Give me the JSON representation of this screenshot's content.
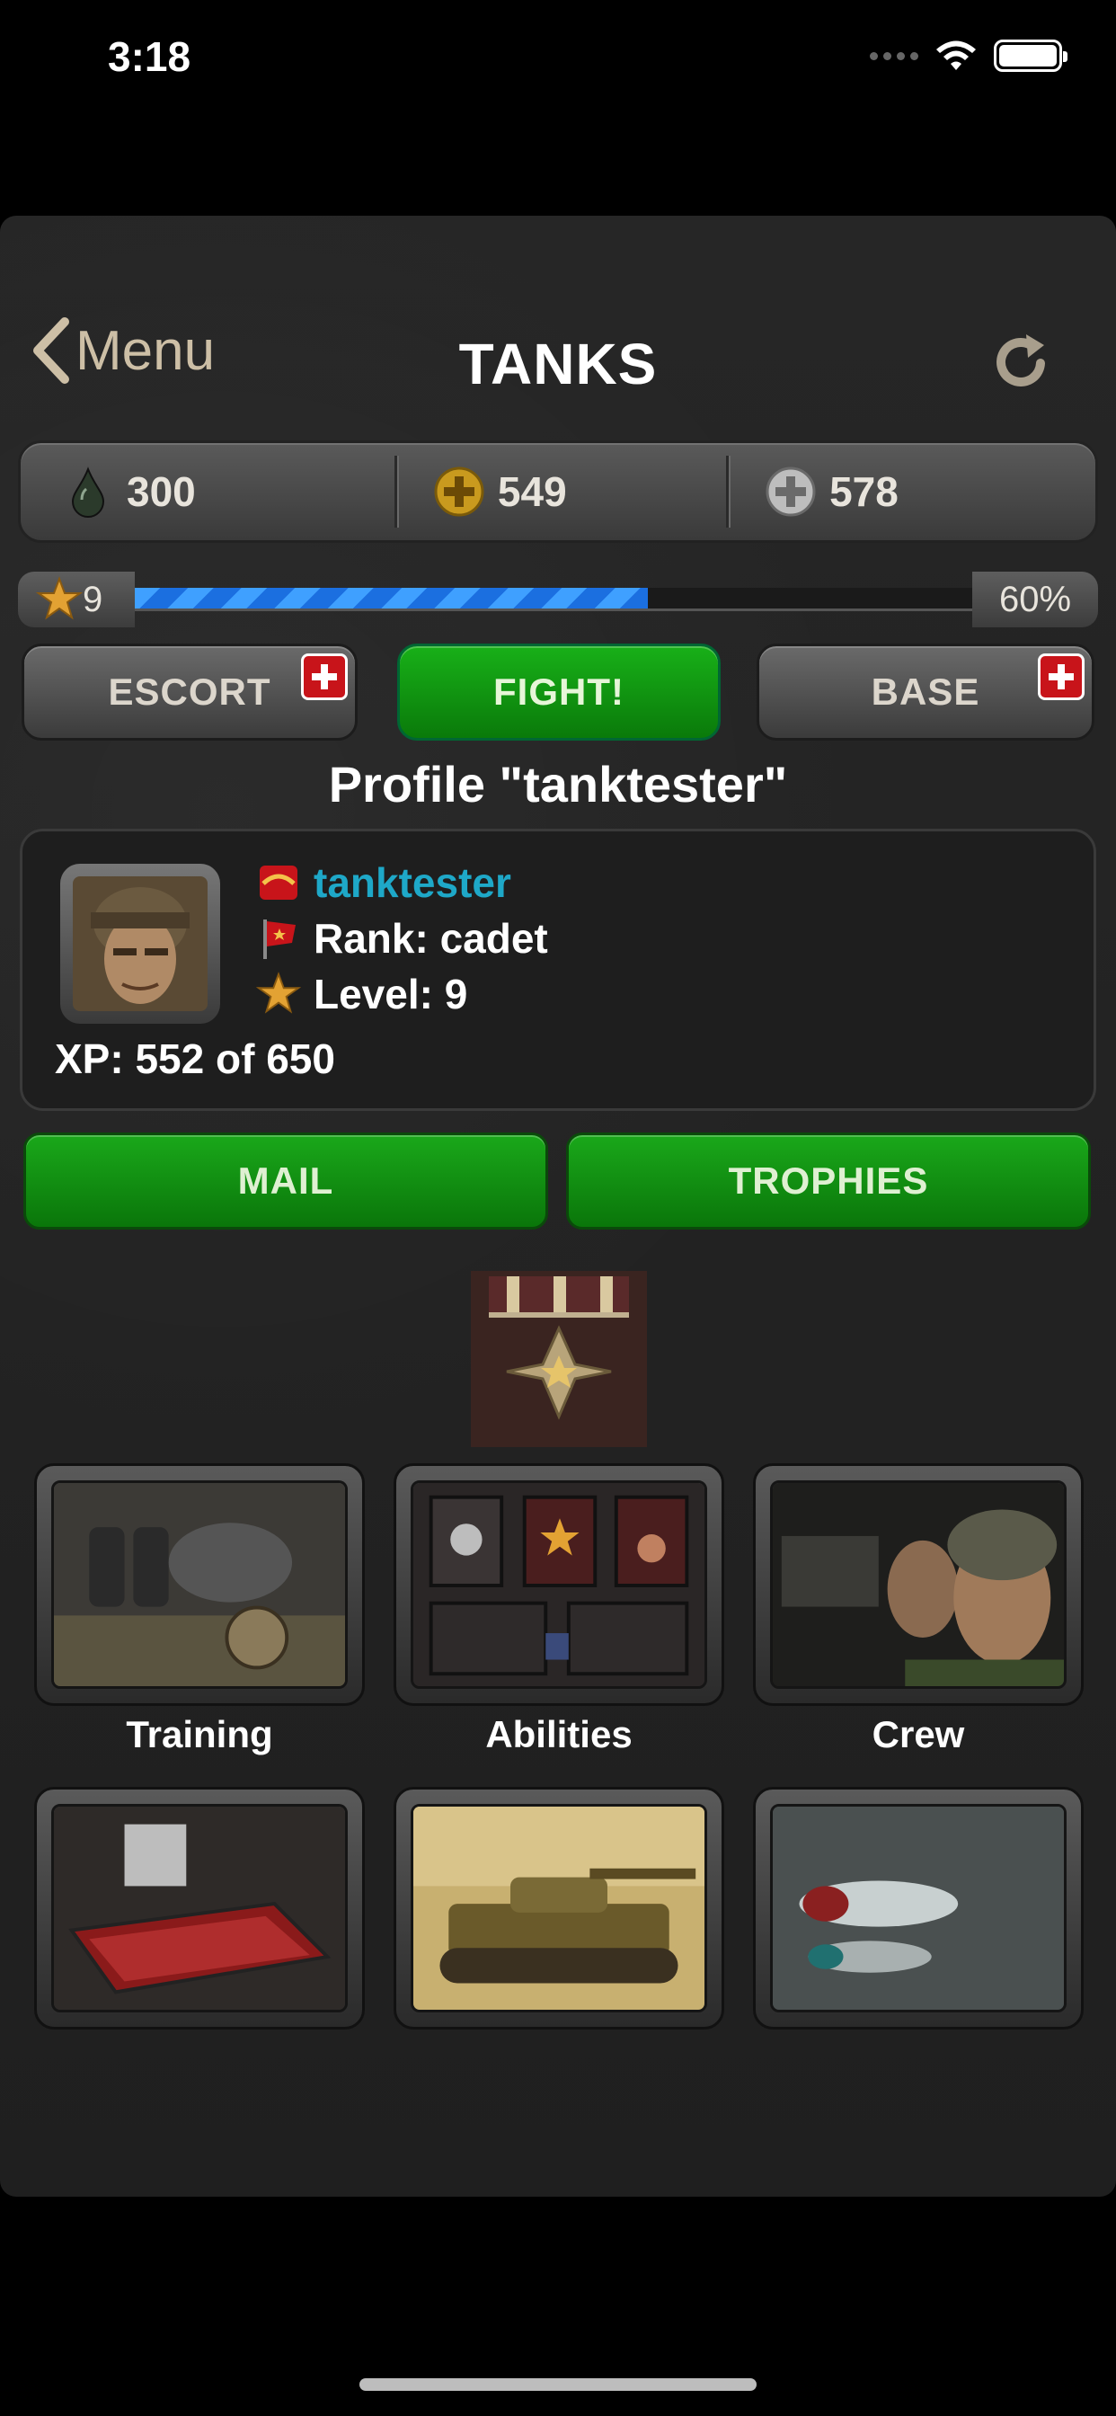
{
  "status_bar": {
    "time": "3:18"
  },
  "nav": {
    "back_label": "Menu",
    "title": "TANKS"
  },
  "currencies": [
    {
      "icon": "fuel-drop-icon",
      "value": "300"
    },
    {
      "icon": "gold-cross-coin-icon",
      "value": "549"
    },
    {
      "icon": "silver-cross-coin-icon",
      "value": "578"
    }
  ],
  "level_bar": {
    "level": "9",
    "progress_percent": 60,
    "progress_label": "60%"
  },
  "actions": {
    "escort_label": "ESCORT",
    "fight_label": "FIGHT!",
    "base_label": "BASE"
  },
  "profile": {
    "heading": "Profile \"tanktester\"",
    "name": "tanktester",
    "rank": "Rank: cadet",
    "level": "Level: 9",
    "xp": "XP: 552 of 650"
  },
  "buttons": {
    "mail_label": "MAIL",
    "trophies_label": "TROPHIES"
  },
  "tiles": [
    {
      "label": "Training"
    },
    {
      "label": "Abilities"
    },
    {
      "label": "Crew"
    }
  ],
  "colors": {
    "accent_green": "#11931a",
    "name_blue": "#1ea8c8",
    "progress_blue": "#1b6fe0"
  }
}
